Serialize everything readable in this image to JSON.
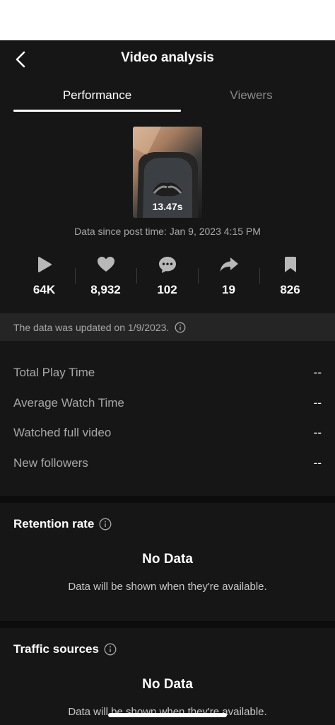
{
  "header": {
    "title": "Video analysis",
    "back_icon": "chevron-left-icon"
  },
  "tabs": [
    {
      "label": "Performance",
      "active": true
    },
    {
      "label": "Viewers",
      "active": false
    }
  ],
  "video": {
    "duration": "13.47s",
    "post_time": "Data since post time: Jan 9, 2023 4:15 PM"
  },
  "stats": [
    {
      "icon": "play-icon",
      "value": "64K"
    },
    {
      "icon": "heart-icon",
      "value": "8,932"
    },
    {
      "icon": "comment-icon",
      "value": "102"
    },
    {
      "icon": "share-icon",
      "value": "19"
    },
    {
      "icon": "bookmark-icon",
      "value": "826"
    }
  ],
  "update_notice": {
    "text": "The data was updated on 1/9/2023.",
    "icon": "info-icon"
  },
  "metrics": [
    {
      "label": "Total Play Time",
      "value": "--"
    },
    {
      "label": "Average Watch Time",
      "value": "--"
    },
    {
      "label": "Watched full video",
      "value": "--"
    },
    {
      "label": "New followers",
      "value": "--"
    }
  ],
  "retention": {
    "title": "Retention rate",
    "no_data": "No Data",
    "message": "Data will be shown when they're available."
  },
  "traffic": {
    "title": "Traffic sources",
    "no_data": "No Data",
    "message": "Data will be shown when they're available."
  },
  "colors": {
    "background": "#161616",
    "muted_text": "#a8a8a8",
    "tab_inactive": "#8a8a8a"
  }
}
